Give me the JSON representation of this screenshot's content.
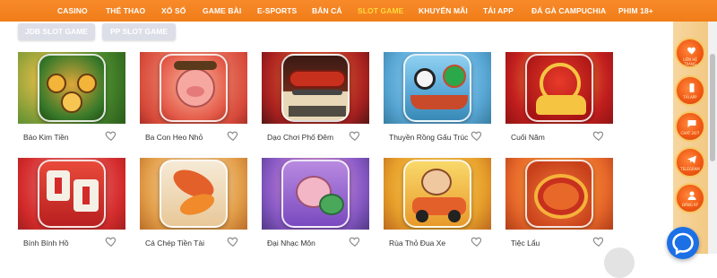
{
  "nav": {
    "items": [
      {
        "label": "CASINO",
        "active": false
      },
      {
        "label": "THỂ THAO",
        "active": false
      },
      {
        "label": "XỔ SỐ",
        "active": false
      },
      {
        "label": "GAME BÀI",
        "active": false
      },
      {
        "label": "E-SPORTS",
        "active": false
      },
      {
        "label": "BẮN CÁ",
        "active": false
      },
      {
        "label": "SLOT GAME",
        "active": true
      },
      {
        "label": "KHUYẾN MÃI",
        "active": false
      },
      {
        "label": "TẢI APP",
        "active": false
      },
      {
        "label": "ĐÁ GÀ CAMPUCHIA",
        "active": false
      },
      {
        "label": "PHIM 18+",
        "active": false
      }
    ],
    "colors": {
      "bar": "#f07d18",
      "text": "#ffffff",
      "active": "#ffd93b"
    }
  },
  "filters": [
    {
      "label": "JDB SLOT GAME"
    },
    {
      "label": "PP SLOT GAME"
    }
  ],
  "games": [
    {
      "name": "Báo Kim Tiền",
      "icon": "leopard-icon",
      "colors": [
        "#3a7a2a",
        "#e0a63a",
        "#1f4d14"
      ]
    },
    {
      "name": "Ba Con Heo Nhỏ",
      "icon": "pig-icon",
      "colors": [
        "#f26a5a",
        "#f3b59a",
        "#b83a2e"
      ]
    },
    {
      "name": "Dạo Chơi Phố Đêm",
      "icon": "sausage-icon",
      "colors": [
        "#b22a2a",
        "#e2572b",
        "#3a1a14"
      ]
    },
    {
      "name": "Thuyền Rồng Gấu Trúc",
      "icon": "panda-dragon-boat-icon",
      "colors": [
        "#5aa9d8",
        "#e8e3d0",
        "#c94a2a"
      ]
    },
    {
      "name": "Cuối Năm",
      "icon": "gold-ingot-icon",
      "colors": [
        "#c41e1e",
        "#f5c542",
        "#7a0f0f"
      ]
    },
    {
      "name": "Bính Bính Hồ",
      "icon": "mahjong-tile-icon",
      "colors": [
        "#d42a2a",
        "#f5f0e6",
        "#8a1a1a"
      ]
    },
    {
      "name": "Cá Chép Tiền Tài",
      "icon": "koi-fish-icon",
      "colors": [
        "#e4a04a",
        "#f3e1c6",
        "#c0591a"
      ]
    },
    {
      "name": "Đại Nhạc Môn",
      "icon": "frog-icon",
      "colors": [
        "#8a5ac8",
        "#f0a6c8",
        "#3a8a5a"
      ]
    },
    {
      "name": "Rùa Thỏ Đua Xe",
      "icon": "race-car-icon",
      "colors": [
        "#f4c042",
        "#e86a2a",
        "#7a3a1a"
      ]
    },
    {
      "name": "Tiệc Lẩu",
      "icon": "hot-pot-icon",
      "colors": [
        "#e8682a",
        "#f5b23a",
        "#9a2a10"
      ]
    }
  ],
  "sidebar_buttons": [
    {
      "label": "LIÊN HỆ TRANG",
      "icon": "heart-chat-icon"
    },
    {
      "label": "TẢI APP",
      "icon": "phone-icon"
    },
    {
      "label": "CHAT 24/7",
      "icon": "chat-icon"
    },
    {
      "label": "TELEGRAM",
      "icon": "telegram-icon"
    },
    {
      "label": "ĐĂNG KÝ",
      "icon": "user-icon"
    }
  ],
  "chat": {
    "icon": "messenger-icon",
    "color": "#1c70e6"
  }
}
